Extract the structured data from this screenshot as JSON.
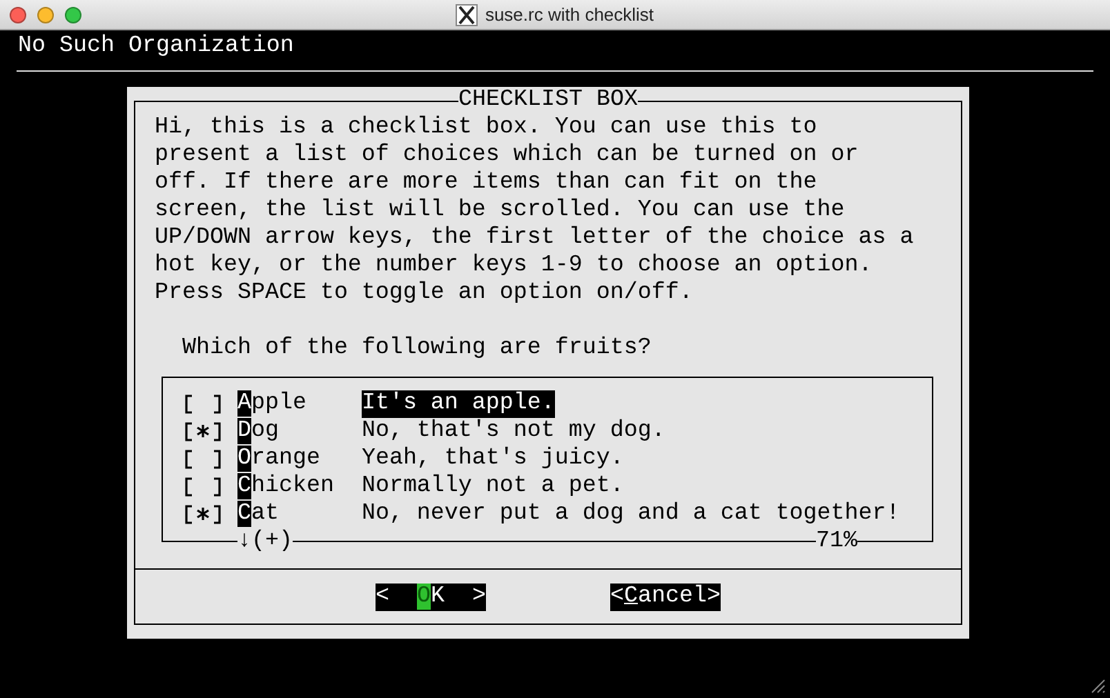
{
  "window": {
    "title": "suse.rc with checklist"
  },
  "terminal": {
    "backtitle": "No Such Organization"
  },
  "dialog": {
    "title": "CHECKLIST BOX",
    "message": "Hi, this is a checklist box. You can use this to\npresent a list of choices which can be turned on or\noff. If there are more items than can fit on the\nscreen, the list will be scrolled. You can use the\nUP/DOWN arrow keys, the first letter of the choice as a\nhot key, or the number keys 1-9 to choose an option.\nPress SPACE to toggle an option on/off.",
    "question": "Which of the following are fruits?",
    "items": [
      {
        "label": "Apple",
        "description": "It's an apple.",
        "checked": false,
        "selected": true
      },
      {
        "label": "Dog",
        "description": "No, that's not my dog.",
        "checked": true,
        "selected": false
      },
      {
        "label": "Orange",
        "description": "Yeah, that's juicy.",
        "checked": false,
        "selected": false
      },
      {
        "label": "Chicken",
        "description": "Normally not a pet.",
        "checked": false,
        "selected": false
      },
      {
        "label": "Cat",
        "description": "No, never put a dog and a cat together!",
        "checked": true,
        "selected": false
      }
    ],
    "scroll_indicator": "↓(+)",
    "scroll_percent": "71%",
    "buttons": [
      {
        "label": "<  OK  >",
        "selected": true
      },
      {
        "label": "<Cancel>",
        "selected": false
      }
    ]
  }
}
